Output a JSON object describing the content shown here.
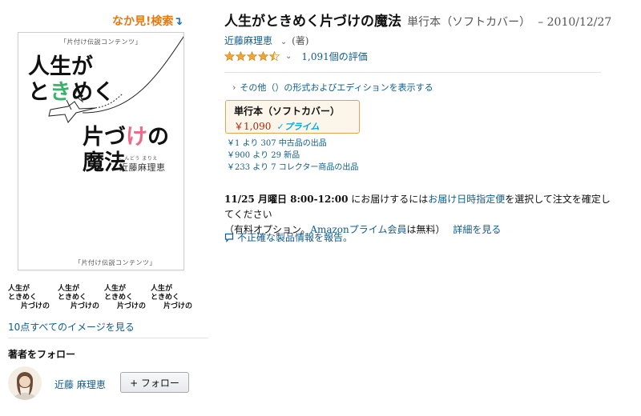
{
  "left": {
    "search_inside": {
      "label": "なか見!検索",
      "arrow": "↴"
    },
    "cover": {
      "top_caption": "「片付け伝説コンテンツ」",
      "title_line1": "人生が",
      "title_line2a": "と",
      "title_line2b": "き",
      "title_line2c": "めく",
      "title_line3a": "片づ",
      "title_line3b": "け",
      "title_line3c": "の",
      "title_line4": "魔法",
      "author_ruby": "こんどう まりえ",
      "author": "近藤麻理恵",
      "bottom_caption": "「片付け伝説コンテンツ」"
    },
    "thumbnails": [
      {
        "line1": "人生が",
        "line2": "ときめく",
        "line3": "片づけの"
      },
      {
        "line1": "人生が",
        "line2": "ときめく",
        "line3": "片づけの"
      },
      {
        "line1": "人生が",
        "line2": "ときめく",
        "line3": "片づけの"
      },
      {
        "line1": "人生が",
        "line2": "ときめく",
        "line3": "片づけの"
      }
    ],
    "see_all_images": "10点すべてのイメージを見る",
    "follow_heading": "著者をフォロー",
    "author_name": "近藤 麻理恵",
    "follow_button": "+ フォロー"
  },
  "product": {
    "title": "人生がときめく片づけの魔法",
    "binding": "単行本（ソフトカバー）",
    "pub_date": "– 2010/12/27",
    "author": "近藤麻理恵",
    "author_chevron": "⌄",
    "author_role": "(著)",
    "rating": 4.5,
    "rating_chevron": "⌄",
    "rating_count": "1,091個の評価",
    "other_editions": "その他（）の形式およびエディションを表示する",
    "other_editions_chevron": "›",
    "format": {
      "name": "単行本（ソフトカバー）",
      "price": "￥1,090",
      "prime": "✓プライム"
    },
    "offers": [
      "￥1 より 307 中古品の出品",
      "￥900 より 29 新品",
      "￥233 より 7 コレクター商品の出品"
    ],
    "delivery": {
      "date": "11/25 月曜日 8:00-12:00",
      "text1": " にお届けするには",
      "link1": "お届け日時指定便",
      "text2": "を選択して注文を確定してください",
      "text3": "（有料オプション。",
      "link2": "Amazonプライム会員",
      "text4": "は無料）",
      "link3": "詳細を見る"
    },
    "report": "不正確な製品情報を報告。"
  },
  "colors": {
    "link": "#0f5c8c",
    "price": "#b12704",
    "prime": "#00a8e1",
    "star": "#f0a535",
    "selected_border": "#e4a54a"
  }
}
